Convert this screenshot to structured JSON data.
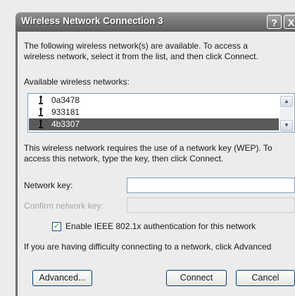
{
  "window": {
    "title": "Wireless Network Connection 3",
    "help": "?",
    "close": "X"
  },
  "intro": {
    "line1": "The following wireless network(s) are available. To access a",
    "line2": "wireless network, select it from the list, and then click Connect."
  },
  "networks_label": "Available wireless networks:",
  "networks": [
    {
      "name": "0a3478",
      "selected": false
    },
    {
      "name": "933181",
      "selected": false
    },
    {
      "name": "4b3307",
      "selected": true
    }
  ],
  "wep_note": {
    "line1": "This wireless network requires the use of a network key (WEP). To",
    "line2": "access this network, type the key, then click Connect."
  },
  "network_key": {
    "label": "Network key:",
    "value": ""
  },
  "confirm_key": {
    "label": "Confirm network key:",
    "value": ""
  },
  "ieee": {
    "label": "Enable IEEE 802.1x authentication for this network",
    "checked": true
  },
  "trouble": "If you are having difficulty connecting to a network, click Advanced",
  "buttons": {
    "advanced": "Advanced...",
    "connect": "Connect",
    "cancel": "Cancel"
  },
  "icons": {
    "network": "antenna-icon",
    "scroll_up": "arrow-up-icon",
    "scroll_down": "arrow-down-icon"
  }
}
